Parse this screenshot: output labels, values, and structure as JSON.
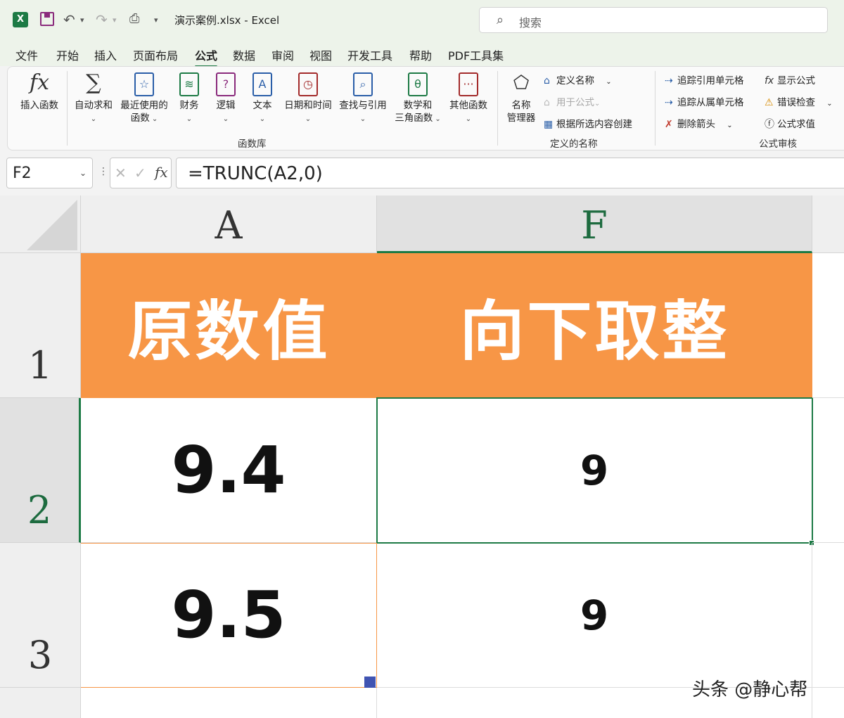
{
  "titlebar": {
    "doc_title": "演示案例.xlsx  -  Excel",
    "search_placeholder": "搜索"
  },
  "menu": {
    "tabs": [
      "文件",
      "开始",
      "插入",
      "页面布局",
      "公式",
      "数据",
      "审阅",
      "视图",
      "开发工具",
      "帮助",
      "PDF工具集"
    ],
    "active": "公式"
  },
  "ribbon": {
    "insert_function": "插入函数",
    "autosum": "自动求和",
    "recent_1": "最近使用的",
    "recent_2": "函数",
    "financial": "财务",
    "logical": "逻辑",
    "text": "文本",
    "datetime": "日期和时间",
    "lookup": "查找与引用",
    "math_1": "数学和",
    "math_2": "三角函数",
    "other": "其他函数",
    "group_library": "函数库",
    "name_mgr_1": "名称",
    "name_mgr_2": "管理器",
    "define_name": "定义名称",
    "use_in_formula": "用于公式",
    "create_from_sel": "根据所选内容创建",
    "group_names": "定义的名称",
    "trace_precedents": "追踪引用单元格",
    "trace_dependents": "追踪从属单元格",
    "remove_arrows": "删除箭头",
    "show_formulas": "显示公式",
    "error_checking": "错误检查",
    "evaluate_formula": "公式求值",
    "group_audit": "公式审核"
  },
  "formula_bar": {
    "name_box": "F2",
    "formula": "=TRUNC(A2,0)"
  },
  "sheet": {
    "columns": [
      "A",
      "F"
    ],
    "rows": [
      "1",
      "2",
      "3"
    ],
    "header_a": "原数值",
    "header_f": "向下取整",
    "a2": "9.4",
    "f2": "9",
    "a3": "9.5",
    "f3": "9"
  },
  "watermark": "头条 @静心帮",
  "colors": {
    "accent": "#1d7a45",
    "header_fill": "#f79646"
  }
}
